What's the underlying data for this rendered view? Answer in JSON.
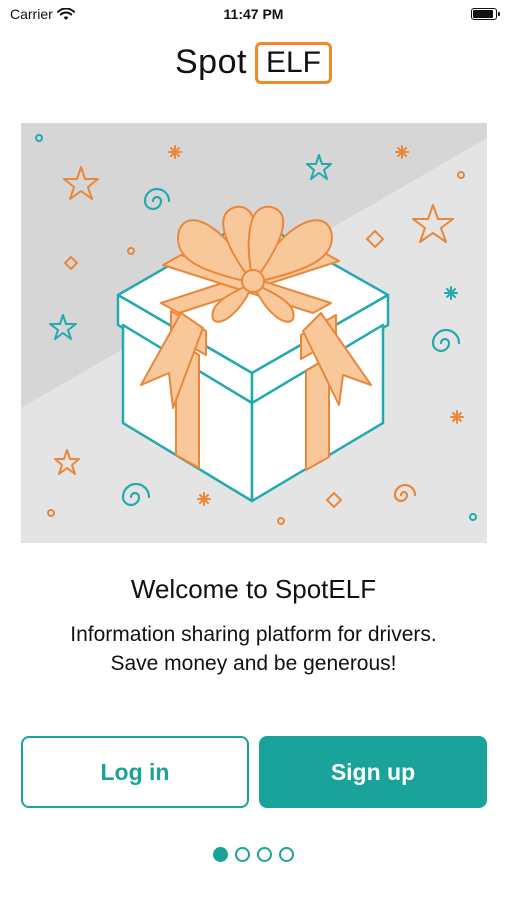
{
  "status_bar": {
    "carrier": "Carrier",
    "time": "11:47 PM",
    "wifi_icon": "wifi-icon",
    "battery_icon": "battery-icon"
  },
  "logo": {
    "spot": "Spot",
    "elf": "ELF"
  },
  "hero": {
    "image": "gift-box-illustration"
  },
  "welcome": {
    "title": "Welcome to SpotELF",
    "body": "Information sharing platform for drivers. Save money and be generous!"
  },
  "buttons": {
    "login_label": "Log in",
    "signup_label": "Sign up"
  },
  "pager": {
    "page_count": 4,
    "active_page": 1
  },
  "colors": {
    "accent": "#1aa39a",
    "logo_border": "#f08a24",
    "ribbon": "#f9c89a",
    "ribbon_stroke": "#e9873a",
    "box_stroke": "#22aab0",
    "hero_bg": "#e4e4e4",
    "hero_bg_dark": "#d6d6d6"
  }
}
